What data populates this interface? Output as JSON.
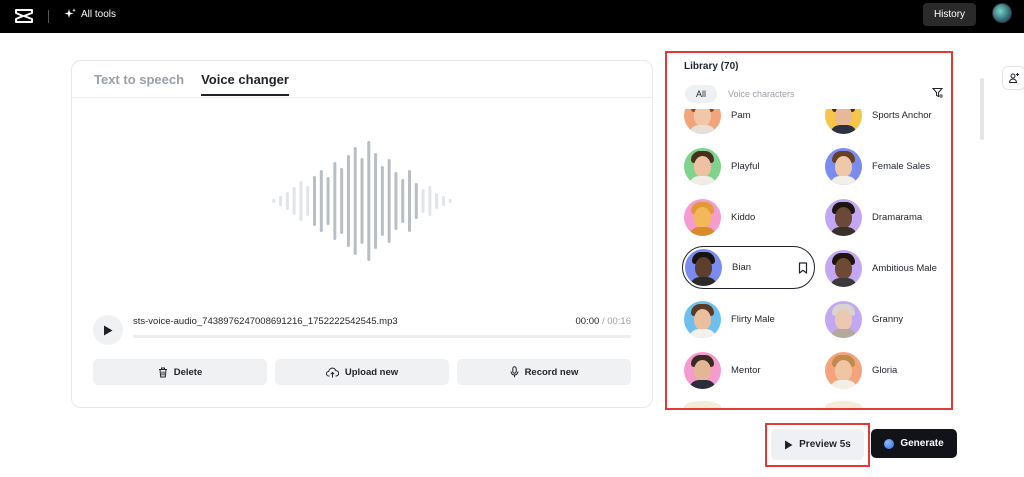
{
  "topbar": {
    "all_tools_label": "All tools",
    "history_label": "History"
  },
  "tabs": [
    {
      "label": "Text to speech",
      "active": false
    },
    {
      "label": "Voice changer",
      "active": true
    }
  ],
  "player": {
    "filename": "sts-voice-audio_7438976247008691216_1752222542545.mp3",
    "current_time": "00:00",
    "total_time": "/ 00:16",
    "progress": 0
  },
  "actions": {
    "delete_label": "Delete",
    "upload_label": "Upload new",
    "record_label": "Record new"
  },
  "library": {
    "title": "Library (70)",
    "filter_all": "All",
    "filter_voice_characters": "Voice characters",
    "voices": [
      {
        "name": "Pam",
        "bg": "#f4a47a"
      },
      {
        "name": "Sports Anchor",
        "bg": "#f6c64a"
      },
      {
        "name": "Playful",
        "bg": "#7fd38a"
      },
      {
        "name": "Female Sales",
        "bg": "#7b8cf0"
      },
      {
        "name": "Kiddo",
        "bg": "#f59bd0"
      },
      {
        "name": "Dramarama",
        "bg": "#c4a7f2"
      },
      {
        "name": "Bian",
        "bg": "#7b8cf0"
      },
      {
        "name": "Ambitious Male",
        "bg": "#c4a7f2"
      },
      {
        "name": "Flirty Male",
        "bg": "#6cc0f0"
      },
      {
        "name": "Granny",
        "bg": "#c4a7f2"
      },
      {
        "name": "Mentor",
        "bg": "#f59bd0"
      },
      {
        "name": "Gloria",
        "bg": "#f4a47a"
      }
    ]
  },
  "footer": {
    "preview_label": "Preview 5s",
    "generate_label": "Generate"
  },
  "colors": {
    "highlight": "#e53935",
    "topbar": "#000000",
    "generate_bg": "#111318"
  }
}
